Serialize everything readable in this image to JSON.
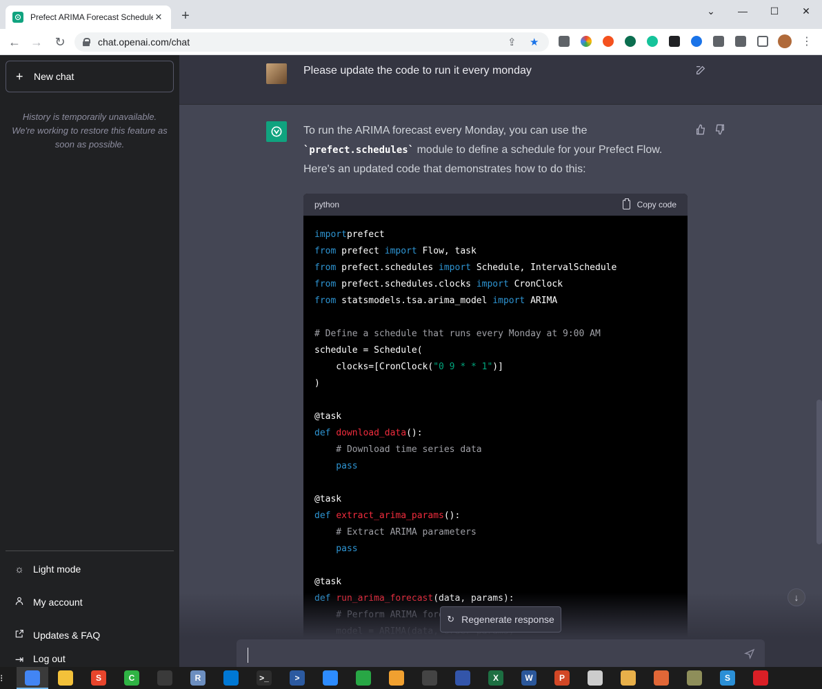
{
  "browser": {
    "tab_title": "Prefect ARIMA Forecast Schedule",
    "tab_close": "✕",
    "new_tab": "+",
    "url": "chat.openai.com/chat",
    "window_minimize": "⌄",
    "window_min": "—",
    "window_max": "☐",
    "window_close": "✕"
  },
  "sidebar": {
    "new_chat_label": "New chat",
    "history_note": "History is temporarily unavailable. We're working to restore this feature as soon as possible.",
    "items": [
      {
        "label": "Light mode",
        "icon": "sun-icon"
      },
      {
        "label": "My account",
        "icon": "user-icon"
      },
      {
        "label": "Updates & FAQ",
        "icon": "external-link-icon"
      },
      {
        "label": "Log out",
        "icon": "logout-icon"
      }
    ]
  },
  "conversation": {
    "user_message": "Please update the code to run it every monday",
    "assistant_intro_part1": "To run the ARIMA forecast every Monday, you can use the ",
    "assistant_intro_code": "`prefect.schedules`",
    "assistant_intro_part2": " module to define a schedule for your Prefect Flow. Here's an updated code that demonstrates how to do this:"
  },
  "code_block": {
    "language": "python",
    "copy_label": "Copy code",
    "lines": [
      [
        [
          "kw",
          "import"
        ],
        [
          "",
          "prefect"
        ]
      ],
      [
        [
          "kw",
          "from"
        ],
        [
          "",
          " prefect "
        ],
        [
          "kw",
          "import"
        ],
        [
          "",
          " Flow, task"
        ]
      ],
      [
        [
          "kw",
          "from"
        ],
        [
          "",
          " prefect.schedules "
        ],
        [
          "kw",
          "import"
        ],
        [
          "",
          " Schedule, IntervalSchedule"
        ]
      ],
      [
        [
          "kw",
          "from"
        ],
        [
          "",
          " prefect.schedules.clocks "
        ],
        [
          "kw",
          "import"
        ],
        [
          "",
          " CronClock"
        ]
      ],
      [
        [
          "kw",
          "from"
        ],
        [
          "",
          " statsmodels.tsa.arima_model "
        ],
        [
          "kw",
          "import"
        ],
        [
          "",
          " ARIMA"
        ]
      ],
      [],
      [
        [
          "cm",
          "# Define a schedule that runs every Monday at 9:00 AM"
        ]
      ],
      [
        [
          "",
          "schedule = Schedule("
        ]
      ],
      [
        [
          "",
          "    clocks=[CronClock("
        ],
        [
          "str",
          "\"0 9 * * 1\""
        ],
        [
          "",
          ")]"
        ]
      ],
      [
        [
          "",
          ")"
        ]
      ],
      [],
      [
        [
          "",
          "@task"
        ]
      ],
      [
        [
          "kw",
          "def"
        ],
        [
          "",
          " "
        ],
        [
          "fn",
          "download_data"
        ],
        [
          "",
          "():"
        ]
      ],
      [
        [
          "cm",
          "    # Download time series data"
        ]
      ],
      [
        [
          "kw",
          "    pass"
        ]
      ],
      [],
      [
        [
          "",
          "@task"
        ]
      ],
      [
        [
          "kw",
          "def"
        ],
        [
          "",
          " "
        ],
        [
          "fn",
          "extract_arima_params"
        ],
        [
          "",
          "():"
        ]
      ],
      [
        [
          "cm",
          "    # Extract ARIMA parameters"
        ]
      ],
      [
        [
          "kw",
          "    pass"
        ]
      ],
      [],
      [
        [
          "",
          "@task"
        ]
      ],
      [
        [
          "kw",
          "def"
        ],
        [
          "",
          " "
        ],
        [
          "fn",
          "run_arima_forecast"
        ],
        [
          "",
          "(data, params):"
        ]
      ],
      [
        [
          "cm-dim",
          "    # Perform ARIMA forecast"
        ]
      ],
      [
        [
          "cm-dim",
          "    model = ARIMA(data, order=params)"
        ]
      ]
    ]
  },
  "regenerate_label": "Regenerate response",
  "colors": {
    "sidebar_bg": "#202123",
    "main_bg": "#343541",
    "assistant_bg": "#444654",
    "accent": "#10a37f",
    "keyword": "#2e95d3",
    "function": "#f22c3d",
    "string": "#00a67d"
  },
  "taskbar_apps": [
    {
      "name": "chrome",
      "color": "#4285f4",
      "label": ""
    },
    {
      "name": "file-explorer",
      "color": "#f3c13a",
      "label": ""
    },
    {
      "name": "wps-writer",
      "color": "#e8452c",
      "label": "S"
    },
    {
      "name": "camtasia",
      "color": "#2fb344",
      "label": "C"
    },
    {
      "name": "obs",
      "color": "#3a3a3a",
      "label": ""
    },
    {
      "name": "r-lang",
      "color": "#6c8ebf",
      "label": "R"
    },
    {
      "name": "vscode",
      "color": "#0078d4",
      "label": ""
    },
    {
      "name": "terminal",
      "color": "#2d2d2d",
      "label": ">_"
    },
    {
      "name": "powershell",
      "color": "#2c5aa0",
      "label": ">"
    },
    {
      "name": "zoom",
      "color": "#2d8cff",
      "label": ""
    },
    {
      "name": "green-ring-app",
      "color": "#28a745",
      "label": ""
    },
    {
      "name": "paint-app",
      "color": "#f0a030",
      "label": ""
    },
    {
      "name": "inkscape",
      "color": "#444444",
      "label": ""
    },
    {
      "name": "network-app",
      "color": "#3355aa",
      "label": ""
    },
    {
      "name": "excel",
      "color": "#1d6f42",
      "label": "X"
    },
    {
      "name": "word",
      "color": "#2b579a",
      "label": "W"
    },
    {
      "name": "powerpoint",
      "color": "#d24726",
      "label": "P"
    },
    {
      "name": "doc-app",
      "color": "#cccccc",
      "label": ""
    },
    {
      "name": "image-app",
      "color": "#e8b04a",
      "label": ""
    },
    {
      "name": "matlab",
      "color": "#e16737",
      "label": ""
    },
    {
      "name": "scan-app",
      "color": "#8e8e5a",
      "label": ""
    },
    {
      "name": "snagit",
      "color": "#2b8fd6",
      "label": "S"
    },
    {
      "name": "creative-cloud",
      "color": "#da1f26",
      "label": ""
    }
  ]
}
